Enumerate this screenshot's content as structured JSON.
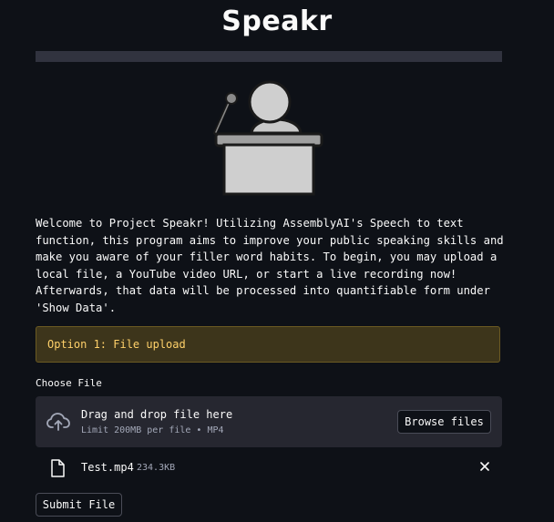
{
  "app": {
    "title": "Speakr"
  },
  "intro": {
    "text": "Welcome to Project Speakr! Utilizing AssemblyAI's Speech to text\nfunction, this program aims to improve your public speaking skills and\nmake you aware of your filler word habits. To begin, you may upload a\nlocal file, a YouTube video URL, or start a live recording now!\nAfterwards, that data will be processed into quantifiable form under\n'Show Data'."
  },
  "alert": {
    "text": "Option 1: File upload",
    "color": "#ffd16a",
    "background": "#3d351b"
  },
  "uploader": {
    "label": "Choose File",
    "drop_text": "Drag and drop file here",
    "limit_text": "Limit 200MB per file • MP4",
    "browse_label": "Browse files",
    "icon": "cloud-upload-icon"
  },
  "uploaded_file": {
    "name": "Test.mp4",
    "size": "234.3KB",
    "icon": "file-icon",
    "remove_icon": "close-icon"
  },
  "actions": {
    "submit_label": "Submit File"
  },
  "illustration": {
    "icon": "speaker-podium-icon"
  },
  "colors": {
    "background": "#0e1117",
    "panel": "#262730",
    "text": "#fafafa",
    "muted_text": "#a3a8b8"
  }
}
